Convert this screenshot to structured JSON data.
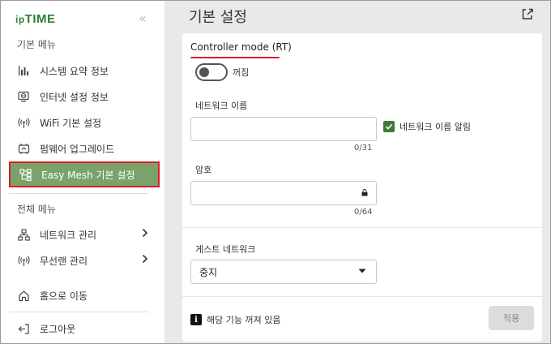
{
  "sidebar": {
    "logo": "ipTIME",
    "collapse_glyph": "«",
    "basic_menu_title": "기본 메뉴",
    "basic_items": [
      {
        "label": "시스템 요약 정보"
      },
      {
        "label": "인터넷 설정 정보"
      },
      {
        "label": "WiFi 기본 설정"
      },
      {
        "label": "펌웨어 업그레이드"
      },
      {
        "label": "Easy Mesh 기본 설정",
        "active": true
      }
    ],
    "full_menu_title": "전체 메뉴",
    "full_items": [
      {
        "label": "네트워크 관리"
      },
      {
        "label": "무선랜 관리"
      }
    ],
    "bottom_items": [
      {
        "label": "홈으로 이동"
      },
      {
        "label": "로그아웃"
      }
    ]
  },
  "main": {
    "title": "기본 설정",
    "controller_mode_label": "Controller mode (RT)",
    "toggle_state": "꺼짐",
    "network_name_label": "네트워크 이름",
    "network_name_value": "",
    "network_name_counter": "0/31",
    "broadcast_label": "네트워크 이름 알림",
    "password_label": "암호",
    "password_value": "",
    "password_counter": "0/64",
    "guest_label": "게스트 네트워크",
    "guest_selected": "중지",
    "info_text": "해당 기능 꺼져 있음",
    "apply_label": "적용"
  },
  "colors": {
    "accent_green": "#7aa36b",
    "logo_green": "#2e7d32",
    "highlight_red": "#e01b24",
    "checkbox_green": "#3f7a36"
  }
}
